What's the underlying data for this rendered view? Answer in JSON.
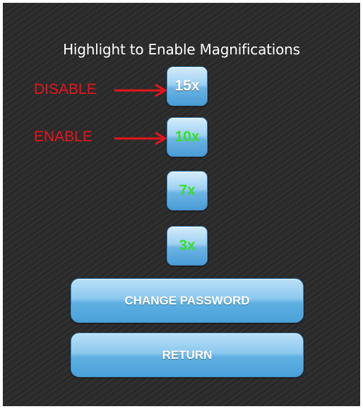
{
  "header": {
    "title": "Highlight to Enable Magnifications"
  },
  "magnifications": [
    {
      "label": "15x",
      "state": "disabled"
    },
    {
      "label": "10x",
      "state": "enabled"
    },
    {
      "label": "7x",
      "state": "enabled"
    },
    {
      "label": "3x",
      "state": "enabled"
    }
  ],
  "annotations": {
    "disable_label": "DISABLE",
    "enable_label": "ENABLE",
    "color": "#e8141b"
  },
  "actions": {
    "change_password_label": "CHANGE PASSWORD",
    "return_label": "RETURN"
  },
  "colors": {
    "enabled_text": "#38e02e",
    "disabled_text": "#ffffff",
    "button_blue": "#5fb0e2",
    "background": "#2b2b2b"
  }
}
